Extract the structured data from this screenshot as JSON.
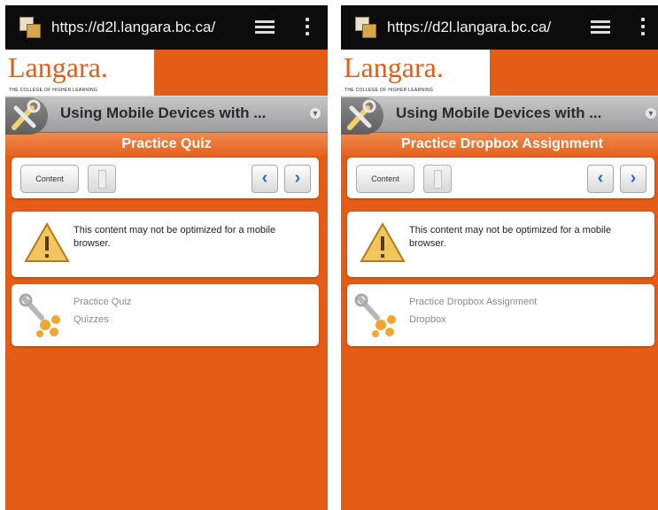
{
  "screens": [
    {
      "browser": {
        "url": "https://d2l.langara.bc.ca/"
      },
      "brand": {
        "logo_text": "Langara.",
        "tagline": "THE COLLEGE OF HIGHER LEARNING"
      },
      "course": {
        "title": "Using Mobile Devices with ..."
      },
      "page_title": "Practice Quiz",
      "nav": {
        "content_label": "Content",
        "prev_icon": "chevron-left-icon",
        "next_icon": "chevron-right-icon"
      },
      "warning": {
        "text": "This content may not be optimized for a mobile browser."
      },
      "item": {
        "title": "Practice Quiz",
        "type": "Quizzes"
      }
    },
    {
      "browser": {
        "url": "https://d2l.langara.bc.ca/"
      },
      "brand": {
        "logo_text": "Langara.",
        "tagline": "THE COLLEGE OF HIGHER LEARNING"
      },
      "course": {
        "title": "Using Mobile Devices with ..."
      },
      "page_title": "Practice Dropbox Assignment",
      "nav": {
        "content_label": "Content",
        "prev_icon": "chevron-left-icon",
        "next_icon": "chevron-right-icon"
      },
      "warning": {
        "text": "This content may not be optimized for a mobile browser."
      },
      "item": {
        "title": "Practice Dropbox Assignment",
        "type": "Dropbox"
      }
    }
  ],
  "colors": {
    "brand_orange": "#e45c16",
    "address_bar": "#0c0c0c",
    "arrow_blue": "#2a6fc9"
  }
}
